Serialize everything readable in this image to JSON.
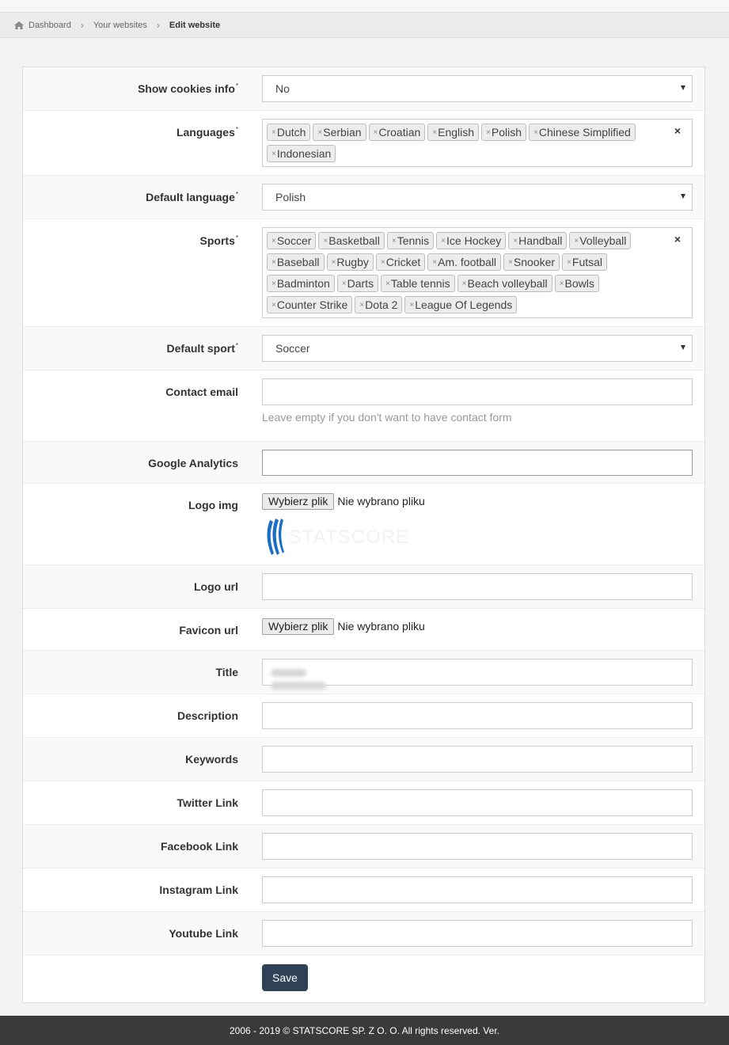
{
  "breadcrumb": {
    "home_icon": "home-icon",
    "items": [
      "Dashboard",
      "Your websites",
      "Edit website"
    ]
  },
  "form": {
    "show_cookies": {
      "label": "Show cookies info",
      "required": "*",
      "value": "No"
    },
    "languages": {
      "label": "Languages",
      "required": "*",
      "tags": [
        "Dutch",
        "Serbian",
        "Croatian",
        "English",
        "Polish",
        "Chinese Simplified",
        "Indonesian"
      ],
      "clear": "×"
    },
    "default_language": {
      "label": "Default language",
      "required": "*",
      "value": "Polish"
    },
    "sports": {
      "label": "Sports",
      "required": "*",
      "tags": [
        "Soccer",
        "Basketball",
        "Tennis",
        "Ice Hockey",
        "Handball",
        "Volleyball",
        "Baseball",
        "Rugby",
        "Cricket",
        "Am. football",
        "Snooker",
        "Futsal",
        "Badminton",
        "Darts",
        "Table tennis",
        "Beach volleyball",
        "Bowls",
        "Counter Strike",
        "Dota 2",
        "League Of Legends"
      ],
      "clear": "×"
    },
    "default_sport": {
      "label": "Default sport",
      "required": "*",
      "value": "Soccer"
    },
    "contact_email": {
      "label": "Contact email",
      "value": "",
      "help": "Leave empty if you don't want to have contact form"
    },
    "google_analytics": {
      "label": "Google Analytics",
      "value": ""
    },
    "logo_img": {
      "label": "Logo img",
      "button": "Wybierz plik",
      "status": "Nie wybrano pliku",
      "logo_text": "STATSCORE"
    },
    "logo_url": {
      "label": "Logo url",
      "value": ""
    },
    "favicon_url": {
      "label": "Favicon url",
      "button": "Wybierz plik",
      "status": "Nie wybrano pliku"
    },
    "title": {
      "label": "Title",
      "value": ""
    },
    "description": {
      "label": "Description",
      "value": ""
    },
    "keywords": {
      "label": "Keywords",
      "value": ""
    },
    "twitter": {
      "label": "Twitter Link",
      "value": ""
    },
    "facebook": {
      "label": "Facebook Link",
      "value": ""
    },
    "instagram": {
      "label": "Instagram Link",
      "value": ""
    },
    "youtube": {
      "label": "Youtube Link",
      "value": ""
    },
    "save_label": "Save"
  },
  "footer": {
    "text": "2006 - 2019 © STATSCORE SP. Z O. O. All rights reserved. Ver."
  },
  "colors": {
    "save_button": "#2f4258",
    "footer": "#3a3a3a",
    "logo_blue": "#1a6fc4"
  }
}
